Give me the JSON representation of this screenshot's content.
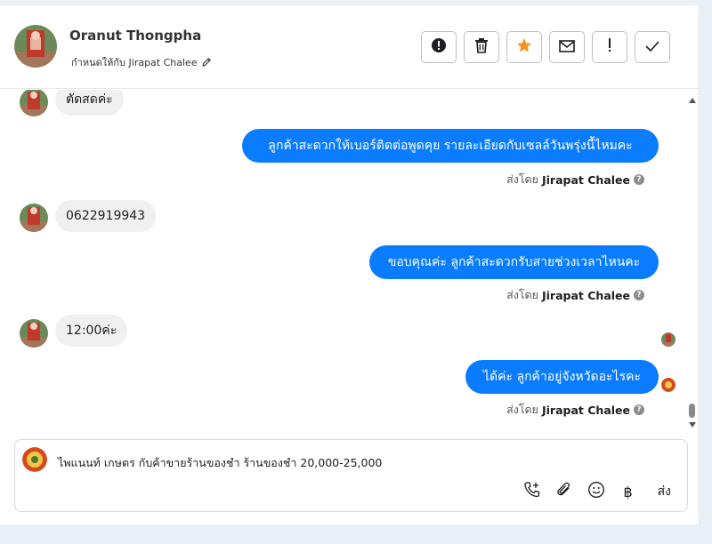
{
  "header": {
    "customer_name": "Oranut Thongpha",
    "assigned_to": "กำหนดให้กับ Jirapat Chalee"
  },
  "messages": {
    "m1": "ตัดสดค่ะ",
    "m2": "ลูกค้าสะดวกให้เบอร์ติดต่อพูดคุย รายละเอียดกับเซลล์วันพรุ่งนี้ไหมคะ",
    "m3": "0622919943",
    "m4": "ขอบคุณค่ะ ลูกค้าสะดวกรับสายช่วงเวลาไหนคะ",
    "m5": "12:00ค่ะ",
    "m6": "ได้ค่ะ  ลูกค้าอยู่จังหวัดอะไรคะ",
    "sent_by_prefix": "ส่งโดย",
    "sent_by_name": "Jirapat Chalee",
    "help_glyph": "?"
  },
  "composer": {
    "text": "ไพแนนท์ เกษตร กับค้าขายร้านของชำ ร้านของชำ 20,000-25,000",
    "send_label": "ส่ง",
    "baht_glyph": "฿"
  },
  "colors": {
    "accent": "#0a7cff",
    "bubble_in": "#f0f0f0"
  },
  "icons": [
    "alert-circle-icon",
    "trash-icon",
    "star-icon",
    "mail-icon",
    "exclamation-icon",
    "check-icon",
    "pencil-icon",
    "phone-plus-icon",
    "paperclip-icon",
    "smiley-icon",
    "baht-icon",
    "help-icon"
  ]
}
